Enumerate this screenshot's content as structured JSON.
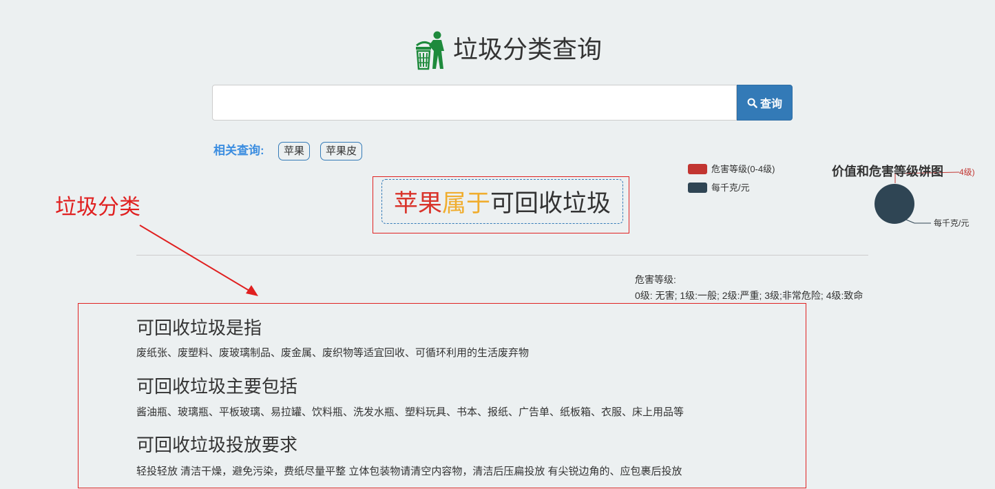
{
  "header": {
    "title": "垃圾分类查询",
    "logo_icon": "trash-can-person-icon"
  },
  "search": {
    "value": "",
    "placeholder": "",
    "button_label": "查询",
    "button_icon": "search-icon"
  },
  "related": {
    "label": "相关查询:",
    "tags": [
      "苹果",
      "苹果皮"
    ]
  },
  "result": {
    "item": "苹果",
    "verb": "属于",
    "category": "可回收垃圾",
    "colors": {
      "item": "#d9342b",
      "verb": "#f0ad2e",
      "category": "#333333"
    }
  },
  "chart_data": {
    "type": "pie",
    "title": "价值和危害等级饼图",
    "legend": [
      {
        "label": "危害等级(0-4级)",
        "color": "#c23531"
      },
      {
        "label": "每千克/元",
        "color": "#2f4554"
      }
    ],
    "slices": [
      {
        "name": "危害等级(0-4级)",
        "value": 0,
        "color": "#c23531"
      },
      {
        "name": "每千克/元",
        "value": 1,
        "color": "#2f4554"
      }
    ],
    "slice_labels": [
      "4级)",
      "每千克/元"
    ]
  },
  "hazard": {
    "title": "危害等级:",
    "levels": "0级: 无害; 1级:一般; 2级:严重; 3级;非常危险; 4级:致命"
  },
  "annotation": {
    "label": "垃圾分类",
    "color": "#e02020"
  },
  "info": [
    {
      "heading": "可回收垃圾是指",
      "text": "废纸张、废塑料、废玻璃制品、废金属、废织物等适宜回收、可循环利用的生活废弃物"
    },
    {
      "heading": "可回收垃圾主要包括",
      "text": "酱油瓶、玻璃瓶、平板玻璃、易拉罐、饮料瓶、洗发水瓶、塑料玩具、书本、报纸、广告单、纸板箱、衣服、床上用品等"
    },
    {
      "heading": "可回收垃圾投放要求",
      "text": "轻投轻放 清洁干燥，避免污染，费纸尽量平整 立体包装物请清空内容物，清洁后压扁投放 有尖锐边角的、应包裹后投放"
    }
  ]
}
